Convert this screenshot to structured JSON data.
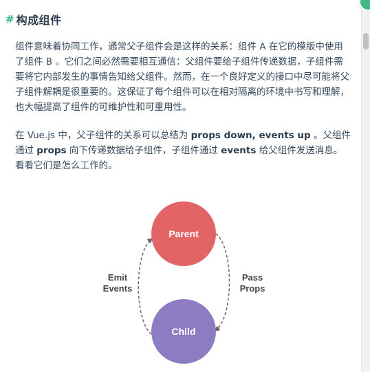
{
  "heading": {
    "hash": "#",
    "title": "构成组件"
  },
  "paragraph1": "组件意味着协同工作，通常父子组件会是这样的关系：组件 A 在它的模版中使用了组件 B 。它们之间必然需要相互通信：父组件要给子组件传递数据，子组件需要将它内部发生的事情告知给父组件。然而，在一个良好定义的接口中尽可能将父子组件解耦是很重要的。这保证了每个组件可以在相对隔离的环境中书写和理解，也大幅提高了组件的可维护性和可重用性。",
  "paragraph2": {
    "part1": "在 Vue.js 中，父子组件的关系可以总结为 ",
    "strong1": "props down, events up",
    "part2": " 。父组件通过 ",
    "strong2": "props",
    "part3": " 向下传递数据给子组件，子组件通过 ",
    "strong3": "events",
    "part4": " 给父组件发送消息。看看它们是怎么工作的。"
  },
  "diagram": {
    "parent_label": "Parent",
    "child_label": "Child",
    "left_label_line1": "Emit",
    "left_label_line2": "Events",
    "right_label_line1": "Pass",
    "right_label_line2": "Props",
    "parent_color": "#e26464",
    "child_color": "#8e7cc3",
    "arrow_color": "#666666",
    "label_color": "#444444"
  }
}
